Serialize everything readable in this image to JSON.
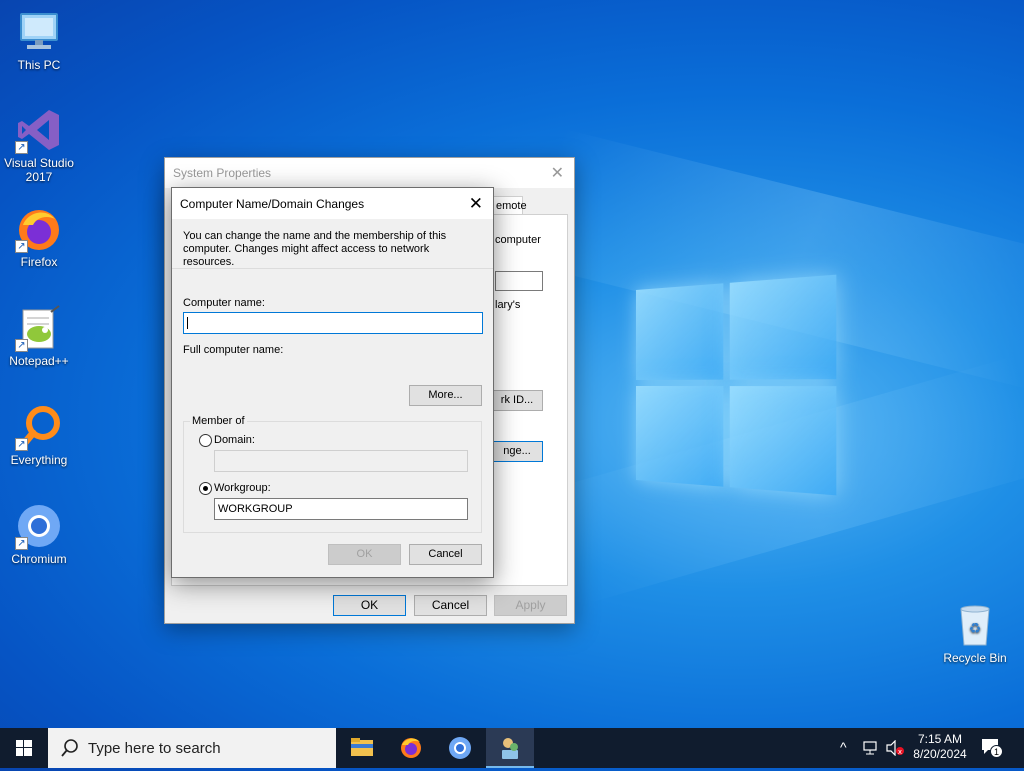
{
  "desktop": {
    "icons": [
      {
        "label": "This PC"
      },
      {
        "label": "Visual Studio 2017"
      },
      {
        "label": "Firefox"
      },
      {
        "label": "Notepad++"
      },
      {
        "label": "Everything"
      },
      {
        "label": "Chromium"
      },
      {
        "label": "Recycle Bin"
      }
    ]
  },
  "system_properties": {
    "title": "System Properties",
    "tab_partial": "emote",
    "partial_text_1": "computer",
    "partial_text_2": "lary's",
    "network_id_partial": "rk ID...",
    "change_partial": "nge...",
    "ok": "OK",
    "cancel": "Cancel",
    "apply": "Apply"
  },
  "dialog": {
    "title": "Computer Name/Domain Changes",
    "description": "You can change the name and the membership of this computer. Changes might affect access to network resources.",
    "computer_name_label": "Computer name:",
    "computer_name_value": "",
    "full_name_label": "Full computer name:",
    "more_button": "More...",
    "member_of_label": "Member of",
    "domain_label": "Domain:",
    "domain_value": "",
    "workgroup_label": "Workgroup:",
    "workgroup_value": "WORKGROUP",
    "ok_button": "OK",
    "cancel_button": "Cancel"
  },
  "taskbar": {
    "search_placeholder": "Type here to search",
    "time": "7:15 AM",
    "date": "8/20/2024",
    "notification_count": "1"
  }
}
